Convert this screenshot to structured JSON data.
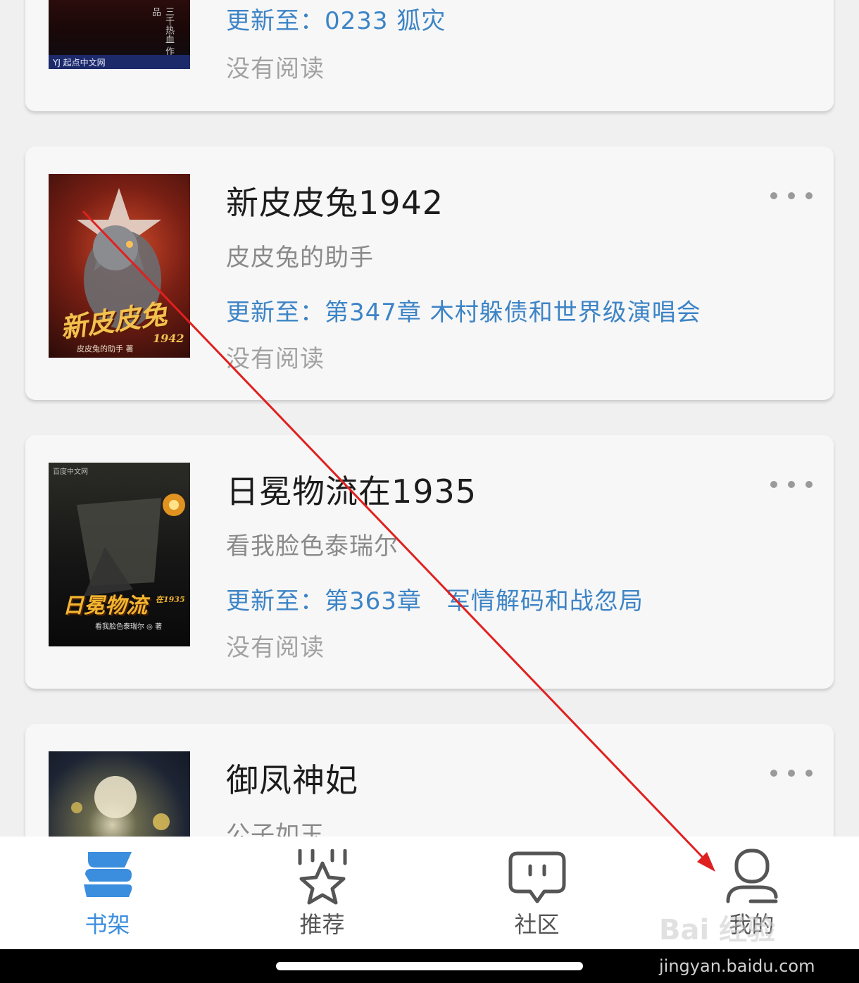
{
  "books": [
    {
      "title": "",
      "author": "",
      "update_prefix": "更新至：",
      "update_chapter": "0233 狐灾",
      "status": "没有阅读",
      "cover": {
        "bg": "#2a0c0c",
        "cover_text": "三千热血 作品",
        "publisher": "YJ 起点中文网",
        "title_text": ""
      }
    },
    {
      "title": "新皮皮兔1942",
      "author": "皮皮兔的助手",
      "update_prefix": "更新至：",
      "update_chapter": "第347章 木村躲债和世界级演唱会",
      "status": "没有阅读",
      "cover": {
        "bg": "#8b2a1e",
        "title_text": "新皮皮兔",
        "sub_text": "1942",
        "author_text": "皮皮兔的助手 著"
      }
    },
    {
      "title": "日冕物流在1935",
      "author": "看我脸色泰瑞尔",
      "update_prefix": "更新至：",
      "update_chapter": "第363章　军情解码和战忽局",
      "status": "没有阅读",
      "cover": {
        "bg": "#1b1b1b",
        "title_text": "日冕物流",
        "sub_text": "在1935",
        "author_text": "看我脸色泰瑞尔 ◎ 著",
        "publisher": "百度中文网"
      }
    },
    {
      "title": "御凤神妃",
      "author": "公子如玉",
      "update_prefix": "",
      "update_chapter": "",
      "status": "",
      "cover": {
        "bg": "#1d2433"
      }
    }
  ],
  "nav": {
    "items": [
      {
        "label": "书架",
        "icon": "bookshelf-icon",
        "active": true
      },
      {
        "label": "推荐",
        "icon": "star-icon",
        "active": false
      },
      {
        "label": "社区",
        "icon": "chat-bubble-icon",
        "active": false
      },
      {
        "label": "我的",
        "icon": "profile-icon",
        "active": false
      }
    ],
    "active_color": "#3b8ede",
    "inactive_color": "#555555"
  },
  "watermark": {
    "logo": "Bai 经验",
    "url": "jingyan.baidu.com"
  },
  "colors": {
    "update": "#3d84c6",
    "title": "#1c1c1c",
    "author": "#8a8a8a",
    "status": "#a2a2a2",
    "annotation_arrow": "#e02020"
  }
}
